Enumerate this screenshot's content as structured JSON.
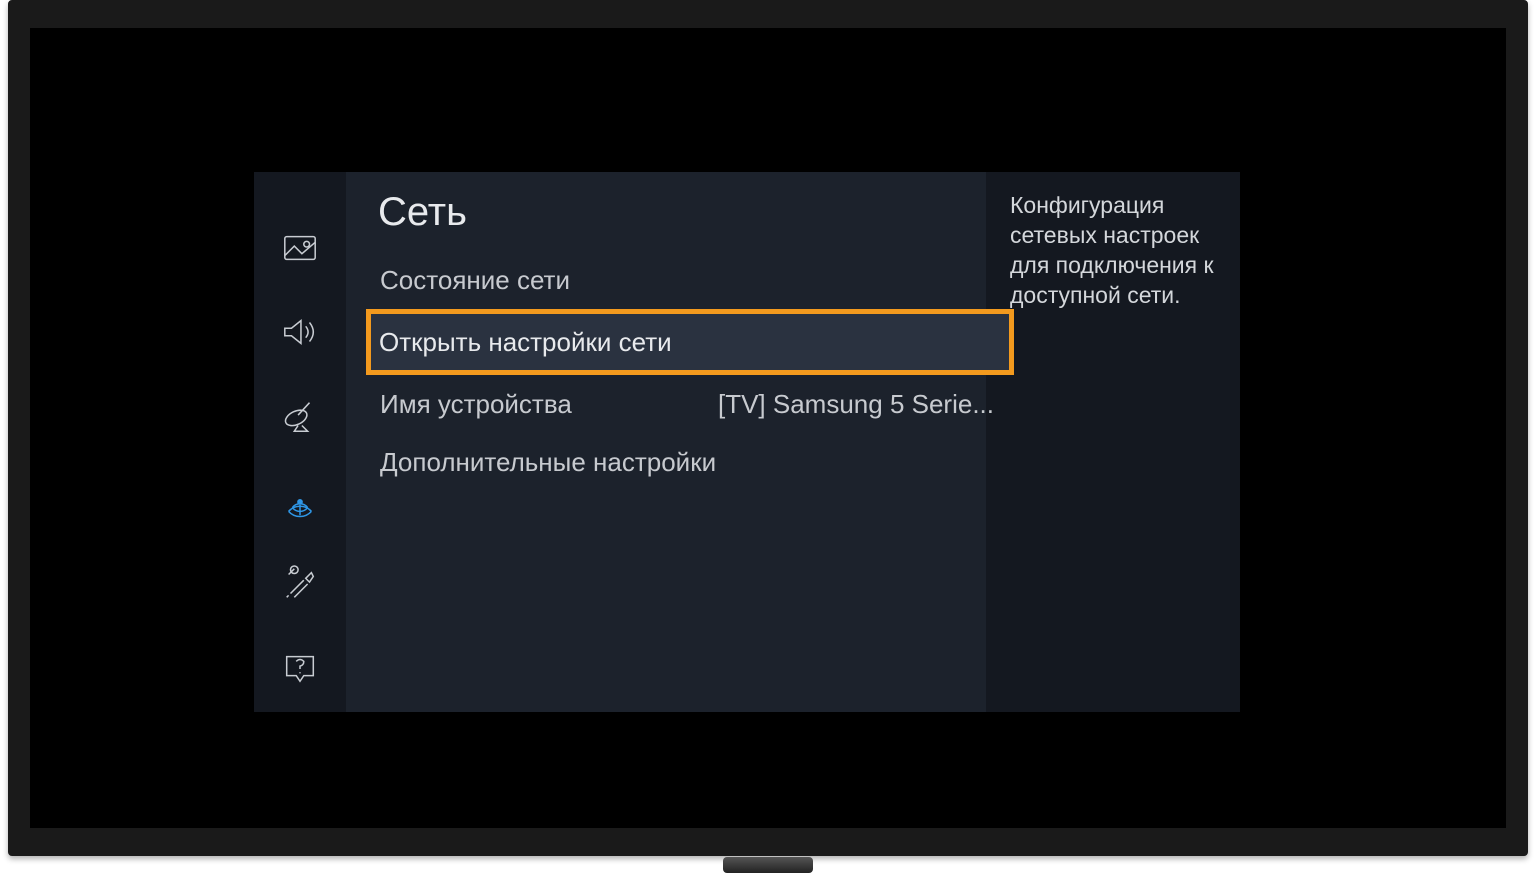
{
  "settings": {
    "title": "Сеть",
    "items": [
      {
        "label": "Состояние сети",
        "value": ""
      },
      {
        "label": "Открыть настройки сети",
        "value": ""
      },
      {
        "label": "Имя устройства",
        "value": "[TV] Samsung 5 Serie..."
      },
      {
        "label": "Дополнительные настройки",
        "value": ""
      }
    ],
    "help": "Конфигурация сетевых настроек для подключения к доступной сети."
  },
  "sidebar": {
    "items": [
      {
        "name": "picture-icon"
      },
      {
        "name": "sound-icon"
      },
      {
        "name": "broadcasting-icon"
      },
      {
        "name": "network-icon"
      },
      {
        "name": "system-icon"
      },
      {
        "name": "support-icon"
      }
    ]
  }
}
